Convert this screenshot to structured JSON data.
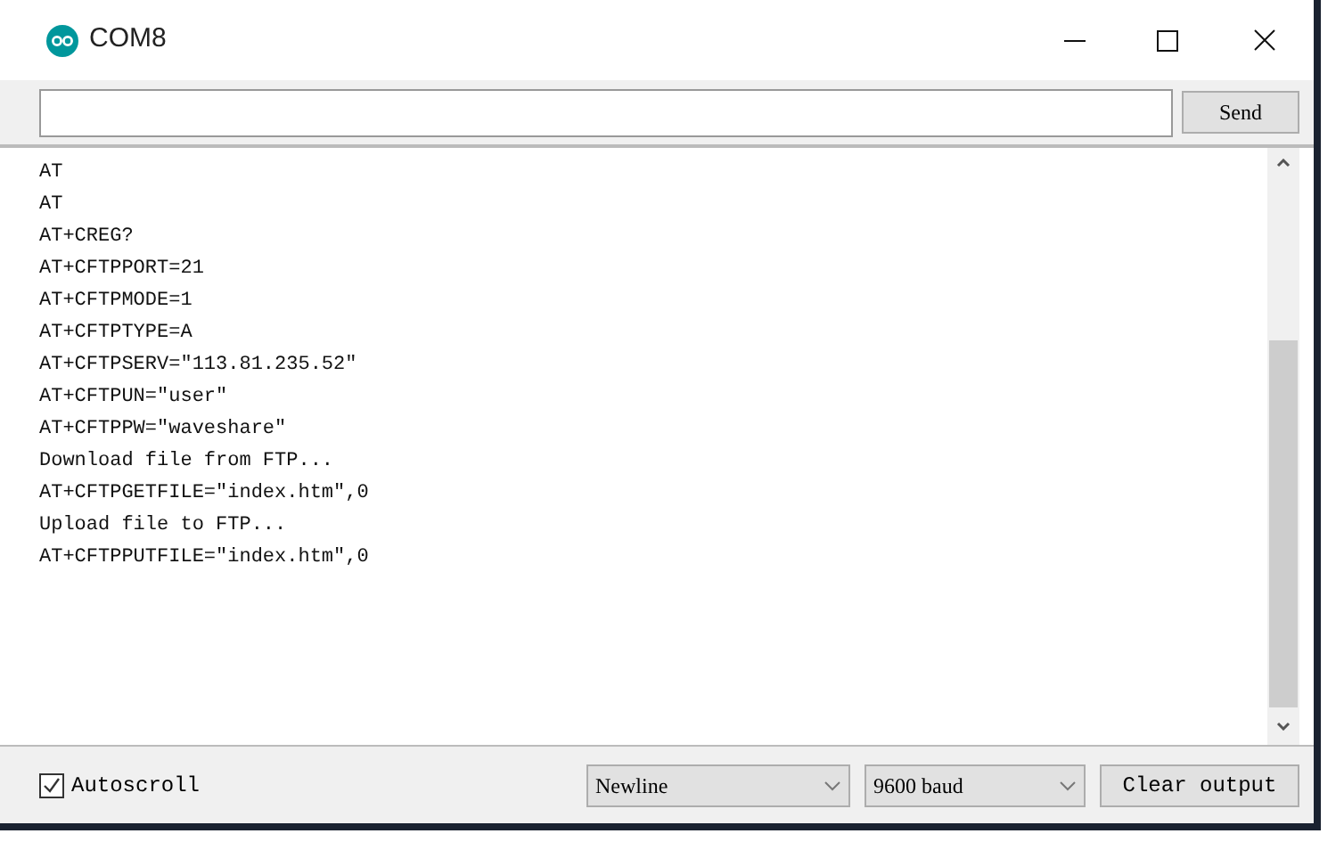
{
  "window": {
    "title": "COM8"
  },
  "send_button": "Send",
  "output_lines": [
    "AT",
    "AT",
    "AT+CREG?",
    "AT+CFTPPORT=21",
    "AT+CFTPMODE=1",
    "AT+CFTPTYPE=A",
    "AT+CFTPSERV=\"113.81.235.52\"",
    "AT+CFTPUN=\"user\"",
    "AT+CFTPPW=\"waveshare\"",
    "Download file from FTP...",
    "AT+CFTPGETFILE=\"index.htm\",0",
    "Upload file to FTP...",
    "AT+CFTPPUTFILE=\"index.htm\",0"
  ],
  "autoscroll": {
    "label": "Autoscroll",
    "checked": true
  },
  "line_ending": {
    "value": "Newline"
  },
  "baud_rate": {
    "value": "9600 baud"
  },
  "clear_button": "Clear output"
}
